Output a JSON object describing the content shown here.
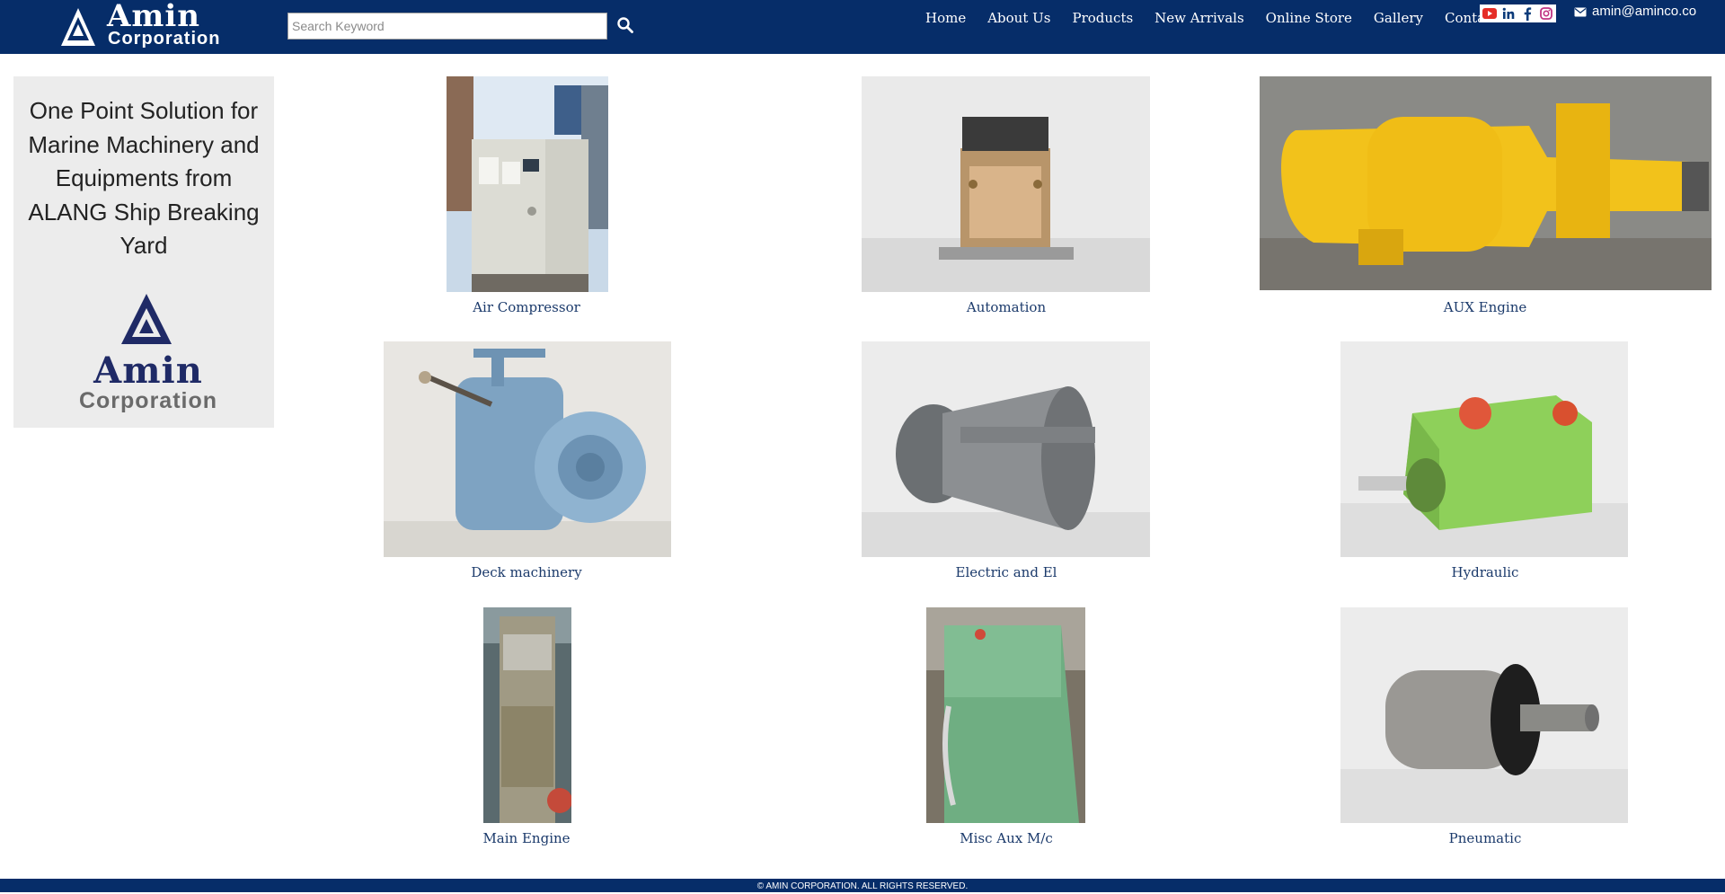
{
  "header": {
    "logo_word": "Amin",
    "logo_sub": "Corporation",
    "search": {
      "placeholder": "Search Keyword",
      "value": ""
    },
    "nav": [
      "Home",
      "About Us",
      "Products",
      "New Arrivals",
      "Online Store",
      "Gallery",
      "Contact Us"
    ],
    "social_icons": [
      "youtube-icon",
      "linkedin-icon",
      "facebook-icon",
      "instagram-icon"
    ],
    "email": "amin@aminco.co"
  },
  "sidebar": {
    "tagline": "One Point Solution for Marine Machinery and Equipments from ALANG Ship Breaking Yard",
    "logo_word": "Amin",
    "logo_sub": "Corporation"
  },
  "products": [
    {
      "label": "Air Compressor"
    },
    {
      "label": "Automation"
    },
    {
      "label": "AUX Engine"
    },
    {
      "label": "Deck machinery"
    },
    {
      "label": "Electric and El"
    },
    {
      "label": "Hydraulic"
    },
    {
      "label": "Main Engine"
    },
    {
      "label": "Misc Aux M/c"
    },
    {
      "label": "Pneumatic"
    }
  ],
  "footer": {
    "copyright": "© AMIN CORPORATION. ALL RIGHTS RESERVED."
  },
  "colors": {
    "brand_navy": "#062d69",
    "link": "#1b3a6b",
    "sidebar_bg": "#ececec"
  }
}
